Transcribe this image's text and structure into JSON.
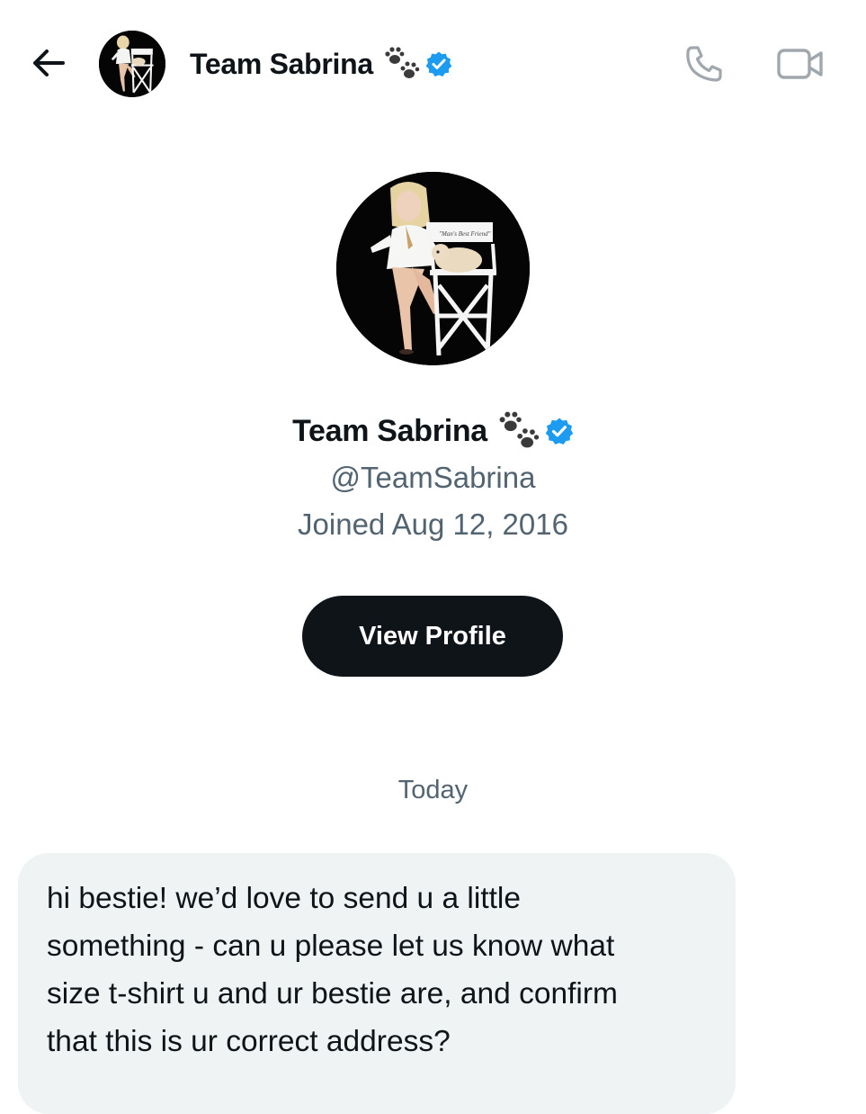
{
  "header": {
    "title": "Team Sabrina",
    "icons": {
      "back": "arrow-left-icon",
      "emoji": "paw-prints-icon",
      "verified": "verified-badge-icon",
      "call": "phone-icon",
      "video": "video-camera-icon"
    }
  },
  "profile": {
    "name": "Team Sabrina",
    "handle": "@TeamSabrina",
    "joined": "Joined Aug 12, 2016",
    "view_profile_label": "View Profile"
  },
  "conversation": {
    "date_separator": "Today",
    "messages": [
      {
        "direction": "incoming",
        "text": "hi bestie! we’d love to send u a little\nsomething - can u please let us know what\nsize t-shirt u and ur bestie are, and confirm\nthat this is ur correct address?"
      }
    ]
  },
  "colors": {
    "text_primary": "#0f1419",
    "text_secondary": "#536471",
    "verified_blue": "#1d9bf0",
    "button_bg": "#0f1419",
    "bubble_bg": "#eff3f4",
    "icon_gray": "#a0a7ad"
  }
}
